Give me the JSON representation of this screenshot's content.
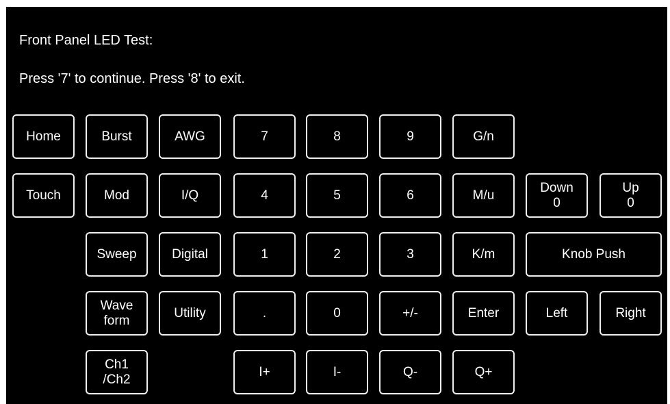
{
  "header": {
    "title": "Front Panel LED Test:",
    "prompt": "Press '7' to continue. Press '8' to exit."
  },
  "keys": {
    "home": "Home",
    "burst": "Burst",
    "awg": "AWG",
    "k7": "7",
    "k8": "8",
    "k9": "9",
    "g_n": "G/n",
    "touch": "Touch",
    "mod": "Mod",
    "iq": "I/Q",
    "k4": "4",
    "k5": "5",
    "k6": "6",
    "m_u": "M/u",
    "down": [
      "Down",
      "0"
    ],
    "up": [
      "Up",
      "0"
    ],
    "sweep": "Sweep",
    "digital": "Digital",
    "k1": "1",
    "k2": "2",
    "k3": "3",
    "k_m": "K/m",
    "knob_push": "Knob Push",
    "waveform": [
      "Wave",
      "form"
    ],
    "utility": "Utility",
    "dot": ".",
    "k0": "0",
    "plus_minus": "+/-",
    "enter": "Enter",
    "left": "Left",
    "right": "Right",
    "ch1ch2": [
      "Ch1",
      "/Ch2"
    ],
    "i_plus": "I+",
    "i_minus": "I-",
    "q_minus": "Q-",
    "q_plus": "Q+"
  }
}
